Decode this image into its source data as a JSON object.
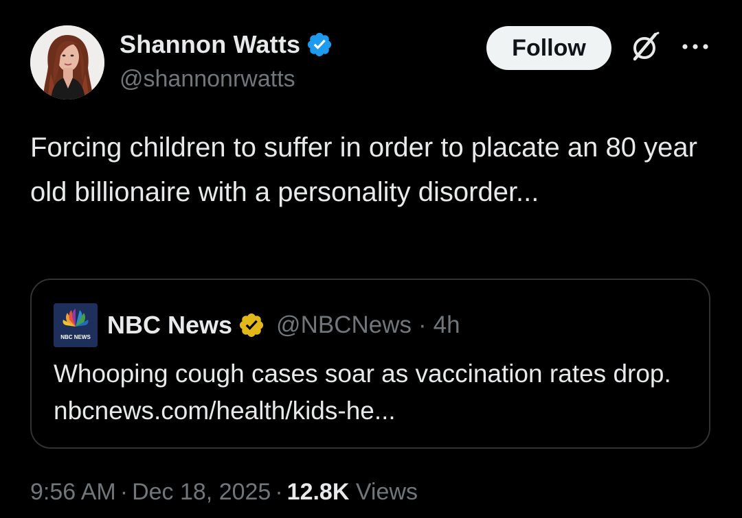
{
  "author": {
    "name": "Shannon Watts",
    "handle": "@shannonrwatts",
    "verified_color": "#1d9bf0"
  },
  "actions": {
    "follow_label": "Follow",
    "grok_icon": "grok-icon",
    "more_icon": "more-horizontal-icon"
  },
  "tweet": {
    "text": "Forcing children to suffer in order to placate an 80 year old billionaire with a personality disorder..."
  },
  "quote": {
    "name": "NBC News",
    "handle": "@NBCNews",
    "separator": "·",
    "time": "4h",
    "text": "Whooping cough cases soar as vaccination rates drop.",
    "link": "nbcnews.com/health/kids-he...",
    "avatar_label": "NBC NEWS",
    "verified_color": "#e2b719"
  },
  "footer": {
    "time": "9:56 AM",
    "separator1": "·",
    "date": "Dec 18, 2025",
    "separator2": "·",
    "views_count": "12.8K",
    "views_label": "Views"
  },
  "colors": {
    "background": "#000000",
    "text": "#e7e9ea",
    "secondary": "#71767b",
    "border": "#2f3336"
  }
}
